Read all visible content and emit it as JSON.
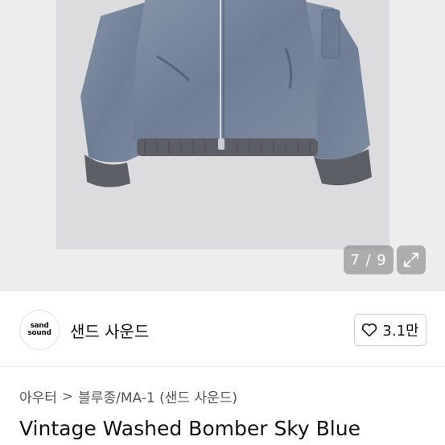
{
  "gallery": {
    "counter": "7 / 9",
    "expand_icon": "expand-icon"
  },
  "shop": {
    "logo_line1": "sand",
    "logo_line2": "sound",
    "name": "샌드 사운드",
    "like_icon": "heart-icon",
    "like_count": "3.1만"
  },
  "breadcrumb": {
    "items": [
      "아우터",
      "블루종/MA-1 (샌드 사운드)"
    ],
    "separator": ">"
  },
  "product": {
    "title": "Vintage Washed Bomber Sky Blue"
  },
  "colors": {
    "jacket": "#76859b",
    "rib": "#5d5f66",
    "photo_bg": "#dcdcdf"
  }
}
